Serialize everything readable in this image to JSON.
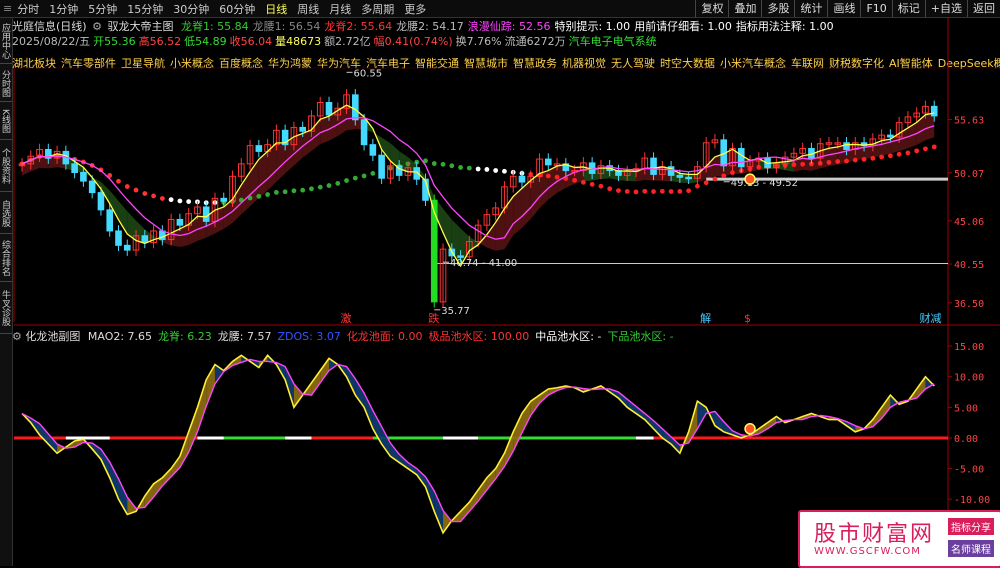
{
  "toolbar": {
    "periods": [
      "分时",
      "1分钟",
      "5分钟",
      "15分钟",
      "30分钟",
      "60分钟",
      "日线",
      "周线",
      "月线",
      "多周期",
      "更多"
    ],
    "active_index": 6,
    "right_buttons": [
      "复权",
      "叠加",
      "多股",
      "统计",
      "画线",
      "F10",
      "标记",
      "+自选",
      "返回"
    ]
  },
  "sidebar_tabs": [
    "应用中心",
    "分时图",
    "K线图",
    "个股资料",
    "自选股",
    "综合排名",
    "牛叉诊股"
  ],
  "main_header": {
    "stock": "光庭信息(日线)",
    "indicator": "驭龙大帝主图",
    "items": [
      {
        "label": "龙脊1: 55.84",
        "color": "#33cc33"
      },
      {
        "label": "龙腰1: 56.54",
        "color": "#888888"
      },
      {
        "label": "龙脊2: 55.64",
        "color": "#ff3333"
      },
      {
        "label": "龙腰2: 54.17",
        "color": "#bbbbbb"
      },
      {
        "label": "浪漫仙踪: 52.56",
        "color": "#ff44ff"
      },
      {
        "label": "特别提示: 1.00",
        "color": "#ffffff"
      },
      {
        "label": "用前请仔细看: 1.00",
        "color": "#ffffff"
      },
      {
        "label": "指标用法注释: 1.00",
        "color": "#ffffff"
      }
    ]
  },
  "quote": {
    "items": [
      {
        "label": "2025/08/22/五",
        "color": "#bbbbbb"
      },
      {
        "label": "开55.36",
        "color": "#33dd33"
      },
      {
        "label": "高56.52",
        "color": "#ff4444"
      },
      {
        "label": "低54.89",
        "color": "#33dd33"
      },
      {
        "label": "收56.04",
        "color": "#ff4444"
      },
      {
        "label": "量48673",
        "color": "#ffff55"
      },
      {
        "label": "额2.72亿",
        "color": "#bbbbbb"
      },
      {
        "label": "幅0.41(0.74%)",
        "color": "#ff4444"
      },
      {
        "label": "换7.76%",
        "color": "#bbbbbb"
      },
      {
        "label": "流通6272万",
        "color": "#bbbbbb"
      },
      {
        "label": "汽车电子电气系统",
        "color": "#33dd33"
      }
    ]
  },
  "concepts": [
    "湖北板块",
    "汽车零部件",
    "卫星导航",
    "小米概念",
    "百度概念",
    "华为鸿蒙",
    "华为汽车",
    "汽车电子",
    "智能交通",
    "智慧城市",
    "智慧政务",
    "机器视觉",
    "无人驾驶",
    "时空大数据",
    "小米汽车概念",
    "车联网",
    "财税数字化",
    "AI智能体",
    "DeepSeek概念"
  ],
  "chart_data": [
    {
      "type": "candlestick",
      "title": "驭龙大帝主图",
      "ylim": [
        34.5,
        61.0
      ],
      "y_ticks": [
        "55.63",
        "50.07",
        "45.06",
        "40.55",
        "36.50"
      ],
      "y_tick_values": [
        55.63,
        50.07,
        45.06,
        40.55,
        36.5
      ],
      "annotations": [
        {
          "text": "60.55",
          "x": 37,
          "y": 60.55
        },
        {
          "text": "35.77",
          "x": 47,
          "y": 35.77
        },
        {
          "text": "40.74 - 41.00",
          "x": 48,
          "y": 40.74
        },
        {
          "text": "49.13 - 49.52",
          "x": 80,
          "y": 49.13
        }
      ],
      "markers": [
        {
          "text": "激",
          "x": 37,
          "color": "#ff3333"
        },
        {
          "text": "跌",
          "x": 47,
          "color": "#ff3333"
        },
        {
          "text": "解",
          "x": 78,
          "color": "#44ccff"
        },
        {
          "text": "$",
          "x": 83,
          "color": "#ff3333"
        },
        {
          "text": "财减",
          "x": 103,
          "color": "#44ccff"
        }
      ],
      "close": [
        51.0,
        51.8,
        52.5,
        51.6,
        52.3,
        51.0,
        50.1,
        49.2,
        48.0,
        46.2,
        44.0,
        42.5,
        42.0,
        43.5,
        42.8,
        44.0,
        43.1,
        45.2,
        44.6,
        45.8,
        46.5,
        45.0,
        47.4,
        47.1,
        49.7,
        51.0,
        52.9,
        52.3,
        53.0,
        54.5,
        53.0,
        54.8,
        54.4,
        56.0,
        57.4,
        56.1,
        56.8,
        58.2,
        55.6,
        53.0,
        51.9,
        49.5,
        50.8,
        49.8,
        50.6,
        49.4,
        47.2,
        36.6,
        42.1,
        41.4,
        41.3,
        42.9,
        44.6,
        45.7,
        46.4,
        48.6,
        49.7,
        49.1,
        49.7,
        51.5,
        50.9,
        51.0,
        50.3,
        50.3,
        51.1,
        50.0,
        50.8,
        50.3,
        49.8,
        50.2,
        50.5,
        51.6,
        49.9,
        50.7,
        49.8,
        49.6,
        49.5,
        50.7,
        53.2,
        53.5,
        50.8,
        52.6,
        50.7,
        51.3,
        51.6,
        50.6,
        51.0,
        51.7,
        52.1,
        52.6,
        51.6,
        53.1,
        53.2,
        53.2,
        52.5,
        53.2,
        52.9,
        53.6,
        54.0,
        53.8,
        55.3,
        55.9,
        56.3,
        57.0,
        56.0
      ],
      "open": [
        50.8,
        51.0,
        51.8,
        52.5,
        51.6,
        52.3,
        51.0,
        50.1,
        49.2,
        48.0,
        46.2,
        44.0,
        42.5,
        42.0,
        43.5,
        42.8,
        44.0,
        43.1,
        45.2,
        44.6,
        45.8,
        46.5,
        45.0,
        47.4,
        47.1,
        49.7,
        51.0,
        52.9,
        52.3,
        53.0,
        54.5,
        53.0,
        54.8,
        54.4,
        56.0,
        57.4,
        56.1,
        56.8,
        58.2,
        55.6,
        53.0,
        51.9,
        49.5,
        50.8,
        49.8,
        50.6,
        49.4,
        47.2,
        36.6,
        42.1,
        41.4,
        41.3,
        42.9,
        44.6,
        45.7,
        46.4,
        48.6,
        49.7,
        49.1,
        49.7,
        51.5,
        50.9,
        51.0,
        50.3,
        50.3,
        51.1,
        50.0,
        50.8,
        50.3,
        49.8,
        50.2,
        50.5,
        51.6,
        49.9,
        50.7,
        49.8,
        49.6,
        49.5,
        50.7,
        53.2,
        53.5,
        50.8,
        52.6,
        50.7,
        51.3,
        51.6,
        50.6,
        51.0,
        51.7,
        52.1,
        52.6,
        51.6,
        53.1,
        53.2,
        53.2,
        52.5,
        53.2,
        52.9,
        53.6,
        54.0,
        53.8,
        55.3,
        55.9,
        56.3,
        57.0
      ],
      "support_line": 40.6,
      "resistance_line": 49.4
    },
    {
      "type": "line",
      "title": "化龙池副图",
      "ylim": [
        -17,
        16
      ],
      "y_ticks": [
        "15.00",
        "10.00",
        "5.00",
        "0.00",
        "-5.00",
        "-10.00",
        "-15.00"
      ],
      "y_tick_values": [
        15,
        10,
        5,
        0,
        -5,
        -10,
        -15
      ],
      "values": [
        4.0,
        2.5,
        0.5,
        -1.0,
        -2.5,
        -1.5,
        -0.5,
        -0.2,
        -1.8,
        -3.5,
        -6.5,
        -10.0,
        -12.5,
        -12.0,
        -9.5,
        -7.5,
        -6.5,
        -5.0,
        -3.0,
        1.0,
        5.0,
        9.5,
        12.0,
        11.0,
        12.5,
        13.5,
        12.5,
        11.5,
        13.5,
        12.0,
        9.5,
        5.0,
        7.0,
        9.0,
        11.0,
        13.0,
        12.0,
        10.0,
        7.0,
        5.0,
        1.5,
        -1.0,
        -3.0,
        -4.0,
        -5.0,
        -6.0,
        -8.0,
        -12.0,
        -15.5,
        -13.5,
        -12.0,
        -10.5,
        -8.5,
        -6.5,
        -5.0,
        -2.5,
        1.0,
        4.0,
        6.0,
        7.0,
        8.0,
        8.2,
        8.5,
        8.2,
        7.5,
        8.0,
        8.5,
        7.5,
        6.5,
        5.0,
        4.0,
        3.0,
        1.5,
        0.0,
        -1.0,
        -2.5,
        1.0,
        6.0,
        5.0,
        2.0,
        1.0,
        0.5,
        0.0,
        0.5,
        1.5,
        2.5,
        3.5,
        2.5,
        3.0,
        3.5,
        4.0,
        3.5,
        3.0,
        3.0,
        2.0,
        1.0,
        1.5,
        3.0,
        5.0,
        7.0,
        5.5,
        6.0,
        8.0,
        10.0,
        8.5
      ],
      "series": [
        {
          "label": "MAO2: 7.65",
          "color": "#dddddd"
        },
        {
          "label": "龙脊: 6.23",
          "color": "#33cc33"
        },
        {
          "label": "龙腰: 7.57",
          "color": "#dddddd"
        },
        {
          "label": "ZDOS: 3.07",
          "color": "#3355ff"
        },
        {
          "label": "化龙池面: 0.00",
          "color": "#ff3333"
        },
        {
          "label": "极品池水区: 100.00",
          "color": "#ff3333"
        },
        {
          "label": "中品池水区: -",
          "color": "#ffffff"
        },
        {
          "label": "下品池水区: -",
          "color": "#33cc33"
        }
      ]
    }
  ],
  "watermark": {
    "title": "股市财富网",
    "url": "WWW.GSCFW.COM",
    "badge1": "指标分享",
    "badge2": "名师课程"
  }
}
